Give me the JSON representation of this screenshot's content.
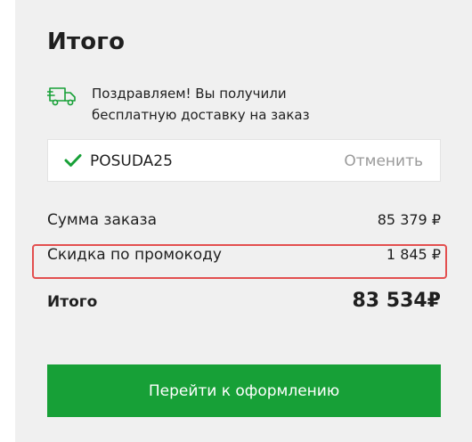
{
  "summary": {
    "title": "Итого",
    "delivery_message": "Поздравляем! Вы получили бесплатную доставку на заказ",
    "promo": {
      "code": "POSUDA25",
      "cancel_label": "Отменить"
    },
    "rows": {
      "order_sum": {
        "label": "Сумма заказа",
        "value": "85 379 ₽"
      },
      "promo_discount": {
        "label": "Скидка по промокоду",
        "value": "1 845 ₽"
      },
      "total": {
        "label": "Итого",
        "value": "83 534₽"
      }
    },
    "checkout_label": "Перейти к оформлению"
  },
  "colors": {
    "accent_green": "#17a037",
    "highlight_red": "#e34f4f",
    "panel_bg": "#f0f0f0",
    "muted_text": "#9a9a9a"
  },
  "icons": {
    "delivery": "delivery-truck-icon",
    "applied": "check-icon"
  }
}
